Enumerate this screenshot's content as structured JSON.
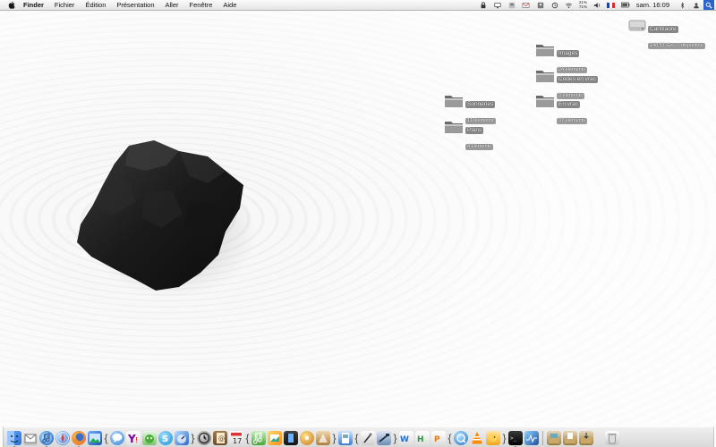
{
  "menubar": {
    "app_name": "Finder",
    "menus": [
      "Fichier",
      "Édition",
      "Présentation",
      "Aller",
      "Fenêtre",
      "Aide"
    ],
    "cpu_top": "21%",
    "cpu_bottom": "71%",
    "clock": "sam. 16:09"
  },
  "desktop": {
    "drive": {
      "name": "Cantilaore",
      "info": "148,57 Go, ... disponible"
    },
    "items": [
      {
        "name": "Images",
        "sub": "24 éléments"
      },
      {
        "name": "Codes en vrac",
        "sub": "3 éléments"
      },
      {
        "name": "En vrac",
        "sub": "37 éléments"
      },
      {
        "name": "Sonneries",
        "sub": "11 éléments"
      },
      {
        "name": "Plans",
        "sub": "4 éléments"
      }
    ]
  },
  "colors": {
    "spotlight": "#2a63c9",
    "rock": "#1c1c1c",
    "sand": "#f2f2f2"
  },
  "dock": {
    "icons": [
      "finder-icon",
      "mail-stamp-icon",
      "itunes-icon",
      "safari-icon",
      "firefox-icon",
      "photo-icon",
      "ichat-icon",
      "yahoo-icon",
      "adium-icon",
      "skype-icon",
      "dashboard-icon",
      "time-machine-icon",
      "address-book-icon",
      "ical-icon",
      "garageband-icon",
      "iphoto-icon",
      "imovie-icon",
      "idvd-icon",
      "iweb-icon",
      "preview-icon",
      "script-editor-icon",
      "xcode-icon",
      "wd-icon",
      "pages-icon",
      "keynote-icon",
      "quicktime-icon",
      "vlc-icon",
      "cyberduck-icon",
      "terminal-icon",
      "activity-monitor-icon",
      "applications-stack-icon",
      "documents-stack-icon",
      "downloads-stack-icon",
      "trash-icon"
    ]
  }
}
